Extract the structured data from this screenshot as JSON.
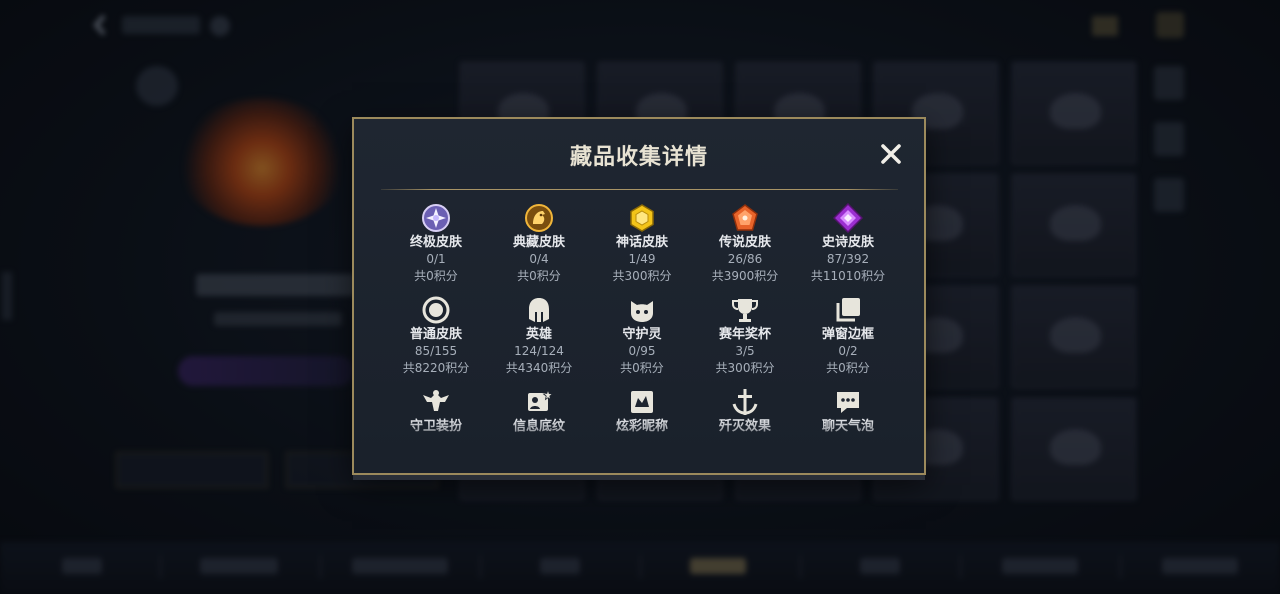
{
  "modal": {
    "title": "藏品收集详情",
    "close_icon": "close-icon",
    "items": [
      {
        "icon": "ultimate-skin-icon",
        "label": "终极皮肤",
        "count": "0/1",
        "points": "共0积分"
      },
      {
        "icon": "collection-skin-icon",
        "label": "典藏皮肤",
        "count": "0/4",
        "points": "共0积分"
      },
      {
        "icon": "mythic-skin-icon",
        "label": "神话皮肤",
        "count": "1/49",
        "points": "共300积分"
      },
      {
        "icon": "legendary-skin-icon",
        "label": "传说皮肤",
        "count": "26/86",
        "points": "共3900积分"
      },
      {
        "icon": "epic-skin-icon",
        "label": "史诗皮肤",
        "count": "87/392",
        "points": "共11010积分"
      },
      {
        "icon": "normal-skin-icon",
        "label": "普通皮肤",
        "count": "85/155",
        "points": "共8220积分"
      },
      {
        "icon": "hero-helmet-icon",
        "label": "英雄",
        "count": "124/124",
        "points": "共4340积分"
      },
      {
        "icon": "guardian-spirit-icon",
        "label": "守护灵",
        "count": "0/95",
        "points": "共0积分"
      },
      {
        "icon": "trophy-icon",
        "label": "赛年奖杯",
        "count": "3/5",
        "points": "共300积分"
      },
      {
        "icon": "popup-frame-icon",
        "label": "弹窗边框",
        "count": "0/2",
        "points": "共0积分"
      },
      {
        "icon": "guard-outfit-icon",
        "label": "守卫装扮",
        "count": "",
        "points": ""
      },
      {
        "icon": "info-background-icon",
        "label": "信息底纹",
        "count": "",
        "points": ""
      },
      {
        "icon": "colorful-nickname-icon",
        "label": "炫彩昵称",
        "count": "",
        "points": ""
      },
      {
        "icon": "annihilation-effect-icon",
        "label": "歼灭效果",
        "count": "",
        "points": ""
      },
      {
        "icon": "chat-bubble-icon",
        "label": "聊天气泡",
        "count": "",
        "points": ""
      }
    ]
  },
  "colors": {
    "accent_gold": "#9c8a5c",
    "modal_bg": "#1e2530",
    "text_primary": "#e6e8ec",
    "text_secondary": "#a7afba"
  }
}
